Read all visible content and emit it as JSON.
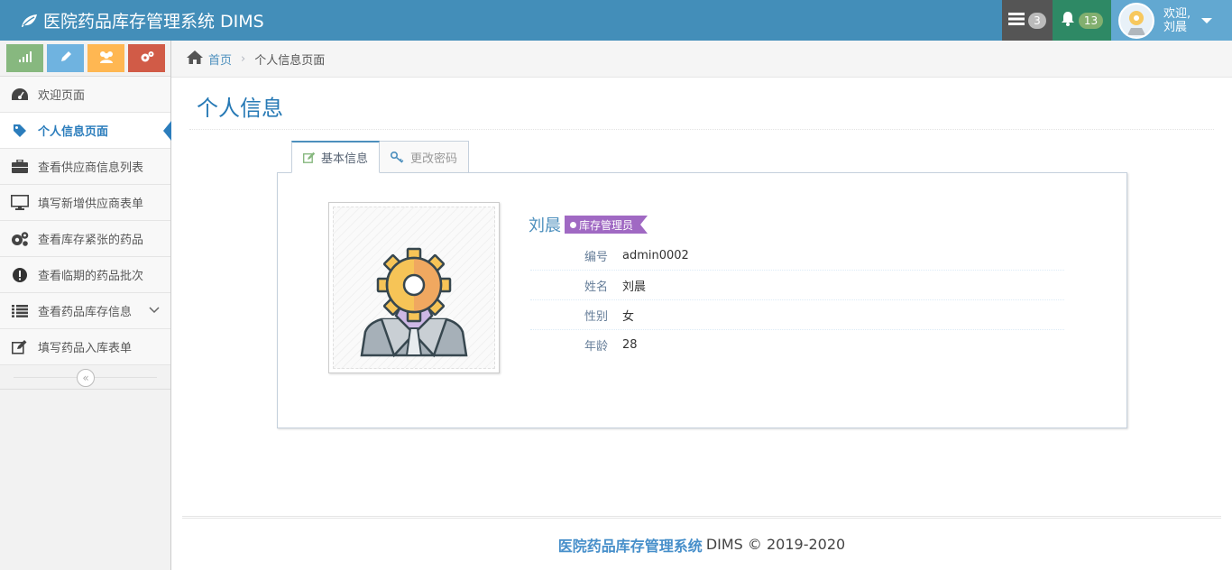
{
  "app": {
    "title": "医院药品库存管理系统 DIMS"
  },
  "navbar": {
    "tasks_count": "3",
    "notifications_count": "13",
    "user_greeting": "欢迎,",
    "user_name": "刘晨"
  },
  "sidebar": {
    "items": [
      {
        "label": "欢迎页面",
        "icon": "dashboard-icon"
      },
      {
        "label": "个人信息页面",
        "icon": "tag-icon"
      },
      {
        "label": "查看供应商信息列表",
        "icon": "briefcase-icon"
      },
      {
        "label": "填写新增供应商表单",
        "icon": "desktop-icon"
      },
      {
        "label": "查看库存紧张的药品",
        "icon": "cogs-icon"
      },
      {
        "label": "查看临期的药品批次",
        "icon": "exclamation-icon"
      },
      {
        "label": "查看药品库存信息",
        "icon": "list-icon"
      },
      {
        "label": "填写药品入库表单",
        "icon": "edit-icon"
      }
    ]
  },
  "breadcrumb": {
    "home": "首页",
    "current": "个人信息页面"
  },
  "page": {
    "title": "个人信息"
  },
  "tabs": [
    {
      "label": "基本信息",
      "icon": "edit-icon"
    },
    {
      "label": "更改密码",
      "icon": "key-icon"
    }
  ],
  "profile": {
    "name": "刘晨",
    "role": "库存管理员",
    "fields": [
      {
        "label": "编号",
        "value": "admin0002"
      },
      {
        "label": "姓名",
        "value": "刘晨"
      },
      {
        "label": "性别",
        "value": "女"
      },
      {
        "label": "年龄",
        "value": "28"
      }
    ]
  },
  "footer": {
    "brand": "医院药品库存管理系统",
    "rest": "DIMS © 2019-2020"
  },
  "colors": {
    "navbar": "#438eb9",
    "accent": "#2b7dbc",
    "role_badge": "#a069c3"
  }
}
